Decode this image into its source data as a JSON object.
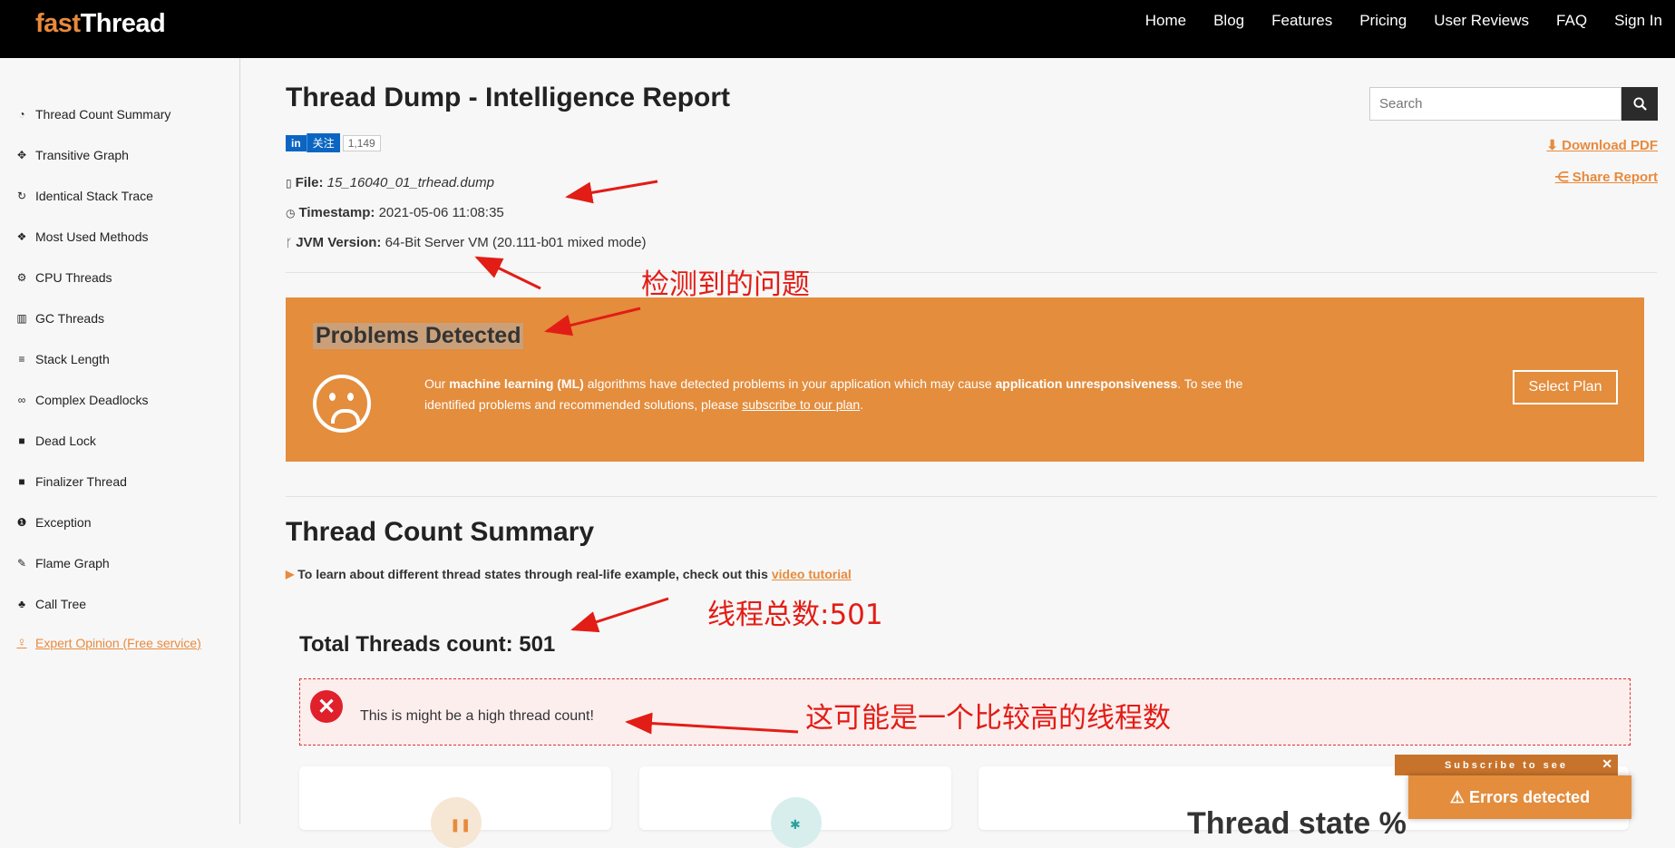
{
  "header": {
    "logo_a": "fast",
    "logo_b": "Thread",
    "nav": [
      "Home",
      "Blog",
      "Features",
      "Pricing",
      "User Reviews",
      "FAQ",
      "Sign In"
    ]
  },
  "sidebar": {
    "items": [
      {
        "label": "Thread Count Summary",
        "icon": "dashboard-icon"
      },
      {
        "label": "Transitive Graph",
        "icon": "move-icon"
      },
      {
        "label": "Identical Stack Trace",
        "icon": "refresh-icon"
      },
      {
        "label": "Most Used Methods",
        "icon": "cubes-icon"
      },
      {
        "label": "CPU Threads",
        "icon": "cogs-icon"
      },
      {
        "label": "GC Threads",
        "icon": "trash-icon"
      },
      {
        "label": "Stack Length",
        "icon": "stairs-icon"
      },
      {
        "label": "Complex Deadlocks",
        "icon": "link-icon"
      },
      {
        "label": "Dead Lock",
        "icon": "lock-icon"
      },
      {
        "label": "Finalizer Thread",
        "icon": "stop-icon"
      },
      {
        "label": "Exception",
        "icon": "exclamation-icon"
      },
      {
        "label": "Flame Graph",
        "icon": "fire-icon"
      },
      {
        "label": "Call Tree",
        "icon": "tree-icon"
      }
    ],
    "expert": "Expert Opinion (Free service)"
  },
  "report": {
    "title": "Thread Dump - Intelligence Report",
    "linkedin": {
      "in": "in",
      "follow": "关注",
      "count": "1,149"
    },
    "file_label": "File:",
    "file_value": "15_16040_01_trhead.dump",
    "timestamp_label": "Timestamp:",
    "timestamp_value": "2021-05-06 11:08:35",
    "jvm_label": "JVM Version:",
    "jvm_value": "64-Bit Server VM (20.111-b01 mixed mode)",
    "download_pdf": "Download PDF",
    "share_report": "Share Report"
  },
  "search": {
    "placeholder": "Search"
  },
  "problems": {
    "heading": "Problems Detected",
    "t1": "Our ",
    "b1": "machine learning (ML)",
    "t2": " algorithms have detected problems in your application which may cause ",
    "b2": "application unresponsiveness",
    "t3": ". To see the identified problems and recommended solutions, please ",
    "link": "subscribe to our plan",
    "t4": ".",
    "button": "Select Plan"
  },
  "summary": {
    "heading": "Thread Count Summary",
    "learn_text": "To learn about different thread states through real-life example, check out this",
    "learn_link": "video tutorial",
    "total": "Total Threads count: 501",
    "alert": "This is might be a high thread count!",
    "card3_title": "Thread state %"
  },
  "popup": {
    "subscribe": "Subscribe to see",
    "errors": "Errors detected"
  },
  "annotations": {
    "problems": "检测到的问题",
    "total": "线程总数:501",
    "high": "这可能是一个比较高的线程数"
  },
  "colors": {
    "accent": "#e38d3d",
    "header": "#000000",
    "annotation": "#e21d16"
  }
}
